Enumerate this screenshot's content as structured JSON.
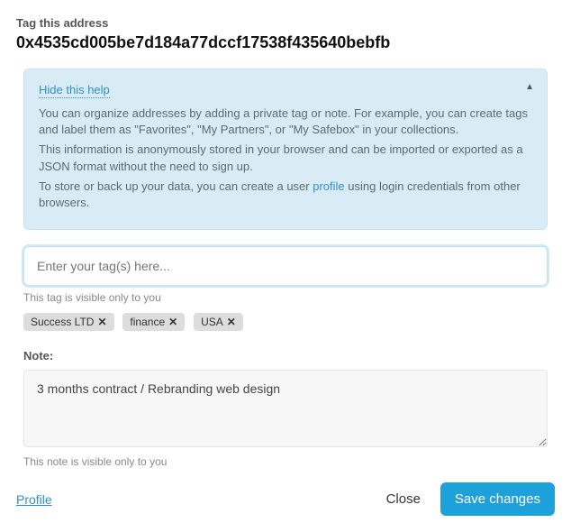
{
  "header": {
    "label": "Tag this address",
    "address": "0x4535cd005be7d184a77dccf17538f435640bebfb"
  },
  "help": {
    "toggle_label": "Hide this help",
    "line1": "You can organize addresses by adding a private tag or note. For example, you can create tags and label them as \"Favorites\", \"My Partners\", or \"My Safebox\" in your collections.",
    "line2": "This information is anonymously stored in your browser and can be imported or exported as a JSON format without the need to sign up.",
    "line3_a": "To store or back up your data, you can create a user ",
    "line3_link": "profile",
    "line3_b": " using login credentials from other browsers."
  },
  "tags": {
    "placeholder": "Enter your tag(s) here...",
    "helper": "This tag is visible only to you",
    "items": [
      {
        "label": "Success LTD"
      },
      {
        "label": "finance"
      },
      {
        "label": "USA"
      }
    ]
  },
  "note": {
    "label": "Note:",
    "value": "3 months contract / Rebranding web design",
    "helper": "This note is visible only to you"
  },
  "footer": {
    "profile_link": "Profile",
    "close": "Close",
    "save": "Save changes"
  }
}
